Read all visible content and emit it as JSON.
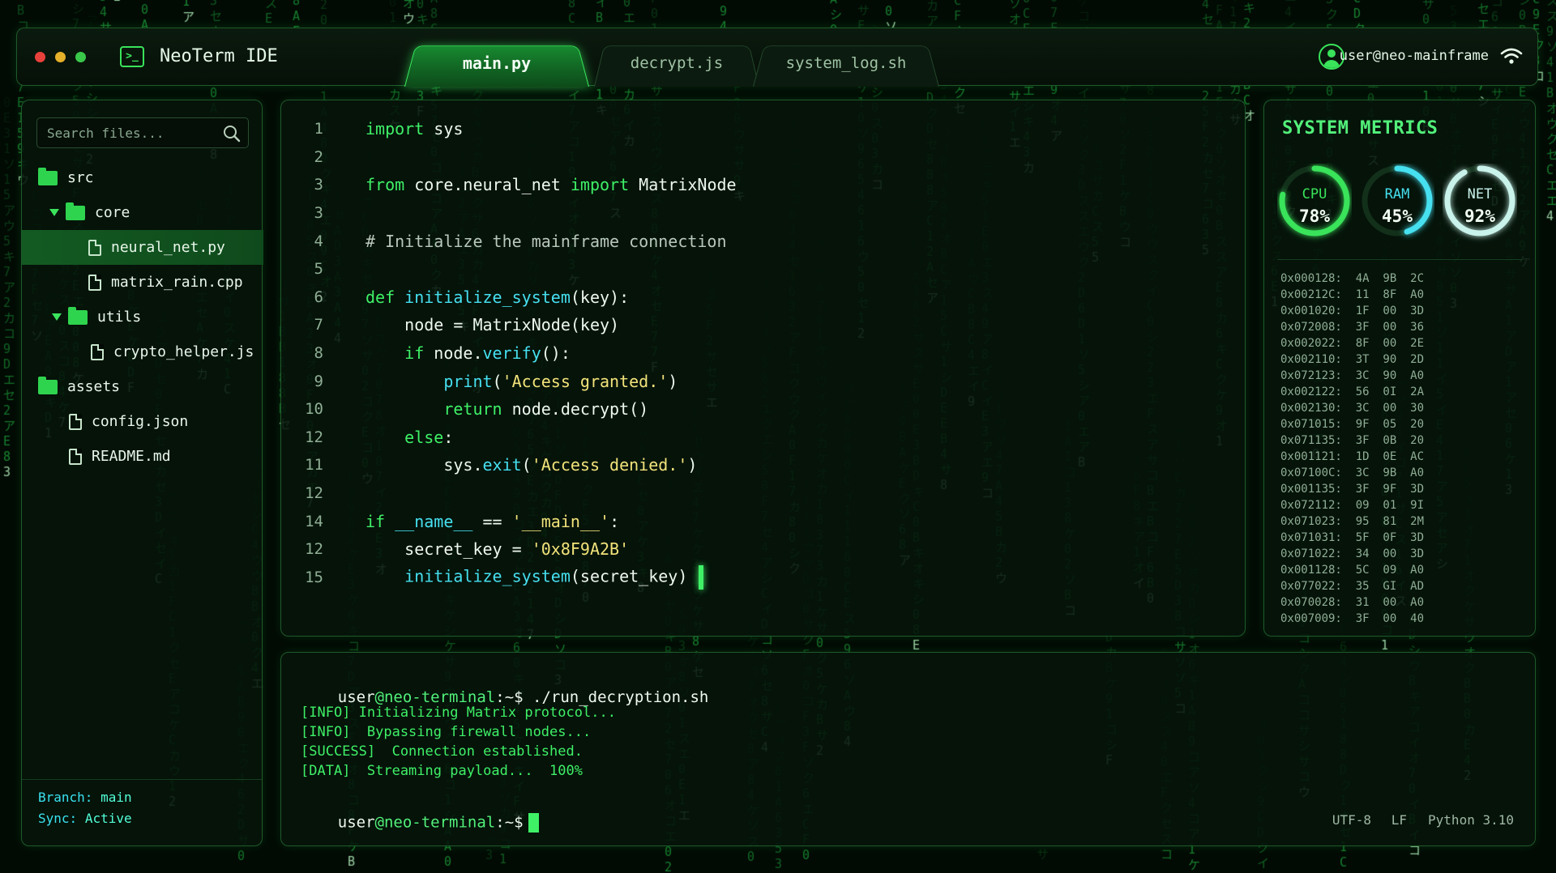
{
  "theme": {
    "accent": "#3ff067",
    "cyan": "#46e0f0",
    "string": "#f2e37a",
    "background": "#020a04"
  },
  "titlebar": {
    "app_title": "NeoTerm IDE",
    "tabs": [
      {
        "label": "main.py",
        "active": true
      },
      {
        "label": "decrypt.js",
        "active": false
      },
      {
        "label": "system_log.sh",
        "active": false
      }
    ],
    "user": "user@neo-mainframe",
    "icons": [
      "terminal-icon",
      "user-icon",
      "wifi-icon"
    ]
  },
  "sidebar": {
    "search_placeholder": "Search files...",
    "tree": [
      {
        "type": "folder",
        "label": "src",
        "level": 0,
        "expanded": true
      },
      {
        "type": "folder",
        "label": "core",
        "level": 1,
        "expanded": true
      },
      {
        "type": "file",
        "label": "neural_net.py",
        "level": 2,
        "selected": true
      },
      {
        "type": "file",
        "label": "matrix_rain.cpp",
        "level": 2
      },
      {
        "type": "folder",
        "label": "utils",
        "level": 1,
        "expanded": true
      },
      {
        "type": "file",
        "label": "crypto_helper.js",
        "level": 2
      },
      {
        "type": "folder",
        "label": "assets",
        "level": 0
      },
      {
        "type": "file",
        "label": "config.json",
        "level": 1
      },
      {
        "type": "file",
        "label": "README.md",
        "level": 1
      }
    ],
    "footer": {
      "branch_label": "Branch:",
      "branch_value": "main",
      "sync_label": "Sync:",
      "sync_value": "Active"
    }
  },
  "editor": {
    "lines": [
      {
        "num": "1",
        "tokens": [
          {
            "t": "import",
            "c": "kw"
          },
          {
            "t": " sys",
            "c": ""
          }
        ]
      },
      {
        "num": "2",
        "tokens": []
      },
      {
        "num": "3",
        "tokens": [
          {
            "t": "from",
            "c": "kw"
          },
          {
            "t": " core.neural_net ",
            "c": ""
          },
          {
            "t": "import",
            "c": "kw"
          },
          {
            "t": " MatrixNode",
            "c": ""
          }
        ]
      },
      {
        "num": "3",
        "tokens": []
      },
      {
        "num": "4",
        "tokens": [
          {
            "t": "# Initialize the mainframe connection",
            "c": "cm"
          }
        ]
      },
      {
        "num": "5",
        "tokens": []
      },
      {
        "num": "6",
        "tokens": [
          {
            "t": "def",
            "c": "kw"
          },
          {
            "t": " ",
            "c": ""
          },
          {
            "t": "initialize_system",
            "c": "fn"
          },
          {
            "t": "(key):",
            "c": ""
          }
        ]
      },
      {
        "num": "7",
        "tokens": [
          {
            "t": "    node = MatrixNode(key)",
            "c": ""
          }
        ]
      },
      {
        "num": "8",
        "tokens": [
          {
            "t": "    ",
            "c": ""
          },
          {
            "t": "if",
            "c": "kw"
          },
          {
            "t": " node.",
            "c": ""
          },
          {
            "t": "verify",
            "c": "fn"
          },
          {
            "t": "():",
            "c": ""
          }
        ]
      },
      {
        "num": "9",
        "tokens": [
          {
            "t": "        ",
            "c": ""
          },
          {
            "t": "print",
            "c": "fn"
          },
          {
            "t": "(",
            "c": ""
          },
          {
            "t": "'Access granted.'",
            "c": "str"
          },
          {
            "t": ")",
            "c": ""
          }
        ]
      },
      {
        "num": "10",
        "tokens": [
          {
            "t": "        ",
            "c": ""
          },
          {
            "t": "return",
            "c": "kw"
          },
          {
            "t": " node.decrypt()",
            "c": ""
          }
        ]
      },
      {
        "num": "12",
        "tokens": [
          {
            "t": "    ",
            "c": ""
          },
          {
            "t": "else",
            "c": "kw"
          },
          {
            "t": ":",
            "c": ""
          }
        ]
      },
      {
        "num": "11",
        "tokens": [
          {
            "t": "        sys.",
            "c": ""
          },
          {
            "t": "exit",
            "c": "fn"
          },
          {
            "t": "(",
            "c": ""
          },
          {
            "t": "'Access denied.'",
            "c": "str"
          },
          {
            "t": ")",
            "c": ""
          }
        ]
      },
      {
        "num": "12",
        "tokens": []
      },
      {
        "num": "14",
        "tokens": [
          {
            "t": "if",
            "c": "kw"
          },
          {
            "t": " ",
            "c": ""
          },
          {
            "t": "__name__",
            "c": "fn"
          },
          {
            "t": " == ",
            "c": ""
          },
          {
            "t": "'__main__'",
            "c": "str"
          },
          {
            "t": ":",
            "c": ""
          }
        ]
      },
      {
        "num": "12",
        "tokens": [
          {
            "t": "    secret_key = ",
            "c": ""
          },
          {
            "t": "'0x8F9A2B'",
            "c": "str"
          }
        ]
      },
      {
        "num": "15",
        "tokens": [
          {
            "t": "    ",
            "c": ""
          },
          {
            "t": "initialize_system",
            "c": "fn"
          },
          {
            "t": "(secret_key)",
            "c": ""
          }
        ],
        "cursor": true
      }
    ]
  },
  "metrics": {
    "title": "SYSTEM METRICS",
    "gauges": [
      {
        "label": "CPU",
        "value": "78%",
        "fraction": 0.78,
        "color": "#39e35a"
      },
      {
        "label": "RAM",
        "value": "45%",
        "fraction": 0.45,
        "color": "#46e0f0"
      },
      {
        "label": "NET",
        "value": "92%",
        "fraction": 0.92,
        "color": "#c8f2ea"
      }
    ],
    "hex_dump": [
      "0x000128:  4A  9B  2C",
      "0x00212C:  11  8F  A0",
      "0x001020:  1F  00  3D",
      "0x072008:  3F  00  36",
      "0x002022:  8F  00  2E",
      "0x002110:  3T  90  2D",
      "0x072123:  3C  90  A0",
      "0x002122:  56  0I  2A",
      "0x002130:  3C  00  30",
      "0x071015:  9F  05  20",
      "0x071135:  3F  0B  20",
      "0x001121:  1D  0E  AC",
      "0x07100C:  3C  9B  A0",
      "0x001135:  3F  9F  3D",
      "0x072112:  09  01  9I",
      "0x071023:  95  81  2M",
      "0x071031:  5F  0F  3D",
      "0x071022:  34  00  3D",
      "0x001128:  5C  09  A0",
      "0x077022:  35  GI  AD",
      "0x070028:  31  00  A0",
      "0x007009:  3F  00  40"
    ]
  },
  "terminal": {
    "prompt_user": "user",
    "prompt_host": "@neo-terminal",
    "prompt_suffix": ":~$",
    "command": " ./run_decryption.sh",
    "output": [
      "[INFO] Initializing Matrix protocol...",
      "[INFO]  Bypassing firewall nodes...",
      "[SUCCESS]  Connection established.",
      "[DATA]  Streaming payload...  100%"
    ],
    "status": {
      "encoding": "UTF-8",
      "line_ending": "LF",
      "language": "Python 3.10"
    }
  }
}
